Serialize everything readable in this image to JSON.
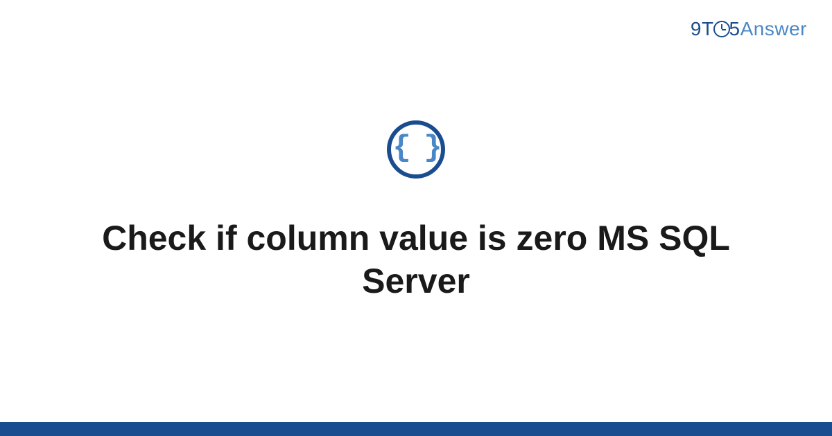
{
  "brand": {
    "part_nine": "9",
    "part_t": "T",
    "part_five": "5",
    "part_answer": "Answer"
  },
  "category": {
    "icon_glyph": "{ }"
  },
  "question": {
    "title": "Check if column value is zero MS SQL Server"
  }
}
